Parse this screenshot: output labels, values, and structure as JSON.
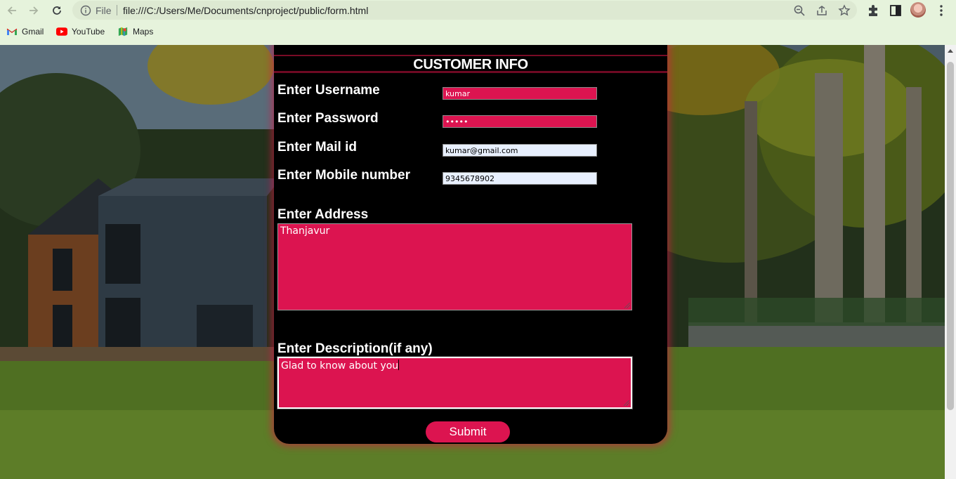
{
  "browser": {
    "url_scheme_label": "File",
    "url": "file:///C:/Users/Me/Documents/cnproject/public/form.html",
    "bookmarks": [
      {
        "label": "Gmail",
        "icon": "gmail-icon"
      },
      {
        "label": "YouTube",
        "icon": "youtube-icon"
      },
      {
        "label": "Maps",
        "icon": "maps-icon"
      }
    ]
  },
  "form": {
    "title": "CUSTOMER INFO",
    "username": {
      "label": "Enter Username",
      "value": "kumar"
    },
    "password": {
      "label": "Enter Password",
      "value": "•••••"
    },
    "mail": {
      "label": "Enter Mail id",
      "value": "kumar@gmail.com"
    },
    "mobile": {
      "label": "Enter Mobile number",
      "value": "9345678902"
    },
    "address": {
      "label": "Enter Address",
      "value": "Thanjavur"
    },
    "description": {
      "label": "Enter Description(if any)",
      "value": "Glad to know about you"
    },
    "submit_label": "Submit"
  },
  "colors": {
    "accent": "#dc1450",
    "card_bg": "#000000",
    "autofill_bg": "#e8f0fe",
    "chrome_bg": "#e6f3dc"
  }
}
